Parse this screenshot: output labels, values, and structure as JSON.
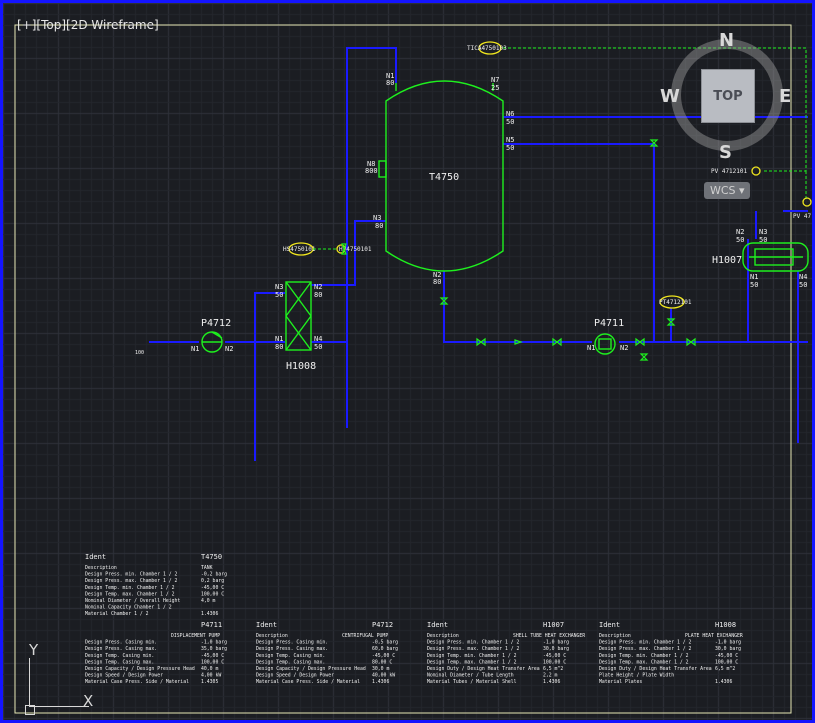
{
  "viewport": {
    "label": "[+][Top][2D Wireframe]",
    "background": "#1b1d22",
    "border_color": "#1414ff",
    "pipe_color": "#1a1aff",
    "equipment_color": "#1ef01e",
    "instrument_color": "#f0e61e",
    "text_color": "#f0f0f0"
  },
  "viewcube": {
    "face": "TOP",
    "north": "N",
    "south": "S",
    "east": "E",
    "west": "W",
    "wcs": "WCS"
  },
  "equipment": {
    "t4750": {
      "tag": "T4750",
      "n1": "N1",
      "n1s": "80",
      "n7": "N7",
      "n7s": "25",
      "n6": "N6",
      "n6s": "50",
      "n5": "N5",
      "n5s": "50",
      "n8": "N8",
      "n8s": "800",
      "n3": "N3",
      "n3s": "80",
      "n2": "N2",
      "n2s": "80"
    },
    "h1008": {
      "tag": "H1008",
      "n3": "N3",
      "n3s": "50",
      "n2": "N2",
      "n2s": "80",
      "n1": "N1",
      "n1s": "80",
      "n4": "N4",
      "n4s": "50"
    },
    "p4712": {
      "tag": "P4712",
      "n1": "N1",
      "n2": "N2",
      "inlet": "100"
    },
    "p4711": {
      "tag": "P4711",
      "n1": "N1",
      "n2": "N2"
    },
    "h1007": {
      "tag": "H1007",
      "n2": "N2",
      "n2s": "50",
      "n3": "N3",
      "n3s": "50",
      "n1": "N1",
      "n1s": "50",
      "n4": "N4",
      "n4s": "50"
    }
  },
  "instruments": {
    "tic": "TICA4750103",
    "hs": "HS4750101",
    "hv": "HV4750101",
    "pt": "PT4712101",
    "pv": "PV 4712101",
    "pvr": "PV 47"
  },
  "tables": {
    "t4750": {
      "header": [
        "Ident",
        "T4750"
      ],
      "rows": [
        [
          "Description",
          "TANK"
        ],
        [
          "Design Press. min. Chamber 1 / 2",
          "-0,2 barg"
        ],
        [
          "Design Press. max. Chamber 1 / 2",
          "0,2 barg"
        ],
        [
          "Design Temp. min. Chamber 1 / 2",
          "-45,00 C"
        ],
        [
          "Design Temp. max. Chamber 1 / 2",
          "100,00 C"
        ],
        [
          "Nominal Diameter / Overall Height",
          "4,0 m"
        ],
        [
          "Nominal Capacity Chamber 1 / 2",
          ""
        ],
        [
          "Material Chamber 1 / 2",
          "1.4306"
        ]
      ]
    },
    "p4711": {
      "header": [
        "",
        "P4711"
      ],
      "rows": [
        [
          "",
          "DISPLACEMENT PUMP"
        ],
        [
          "Design Press. Casing min.",
          "-1,0 barg"
        ],
        [
          "Design Press. Casing max.",
          "35,0 barg"
        ],
        [
          "Design Temp. Casing min.",
          "-45,00 C"
        ],
        [
          "Design Temp. Casing max.",
          "100,00 C"
        ],
        [
          "Design Capacity / Design Pressure Head",
          "40,0 m"
        ],
        [
          "Design Speed / Design Power",
          "4,00 kW"
        ],
        [
          "Material Case Press. Side / Material",
          "1.4305"
        ]
      ]
    },
    "p4712": {
      "header": [
        "Ident",
        "P4712"
      ],
      "rows": [
        [
          "Description",
          "CENTRIFUGAL PUMP"
        ],
        [
          "Design Press. Casing min.",
          "-0,5 barg"
        ],
        [
          "Design Press. Casing max.",
          "60,0 barg"
        ],
        [
          "Design Temp. Casing min.",
          "-45,00 C"
        ],
        [
          "Design Temp. Casing max.",
          "80,00 C"
        ],
        [
          "Design Capacity / Design Pressure Head",
          "30,0 m"
        ],
        [
          "Design Speed / Design Power",
          "40,00 kW"
        ],
        [
          "Material Case Press. Side / Material",
          "1.4306"
        ]
      ]
    },
    "h1007": {
      "header": [
        "Ident",
        "H1007"
      ],
      "rows": [
        [
          "Description",
          "SHELL TUBE HEAT EXCHANGER"
        ],
        [
          "Design Press. min. Chamber 1 / 2",
          "-1,0 barg"
        ],
        [
          "Design Press. max. Chamber 1 / 2",
          "30,0 barg"
        ],
        [
          "Design Temp. min. Chamber 1 / 2",
          "-45,00 C"
        ],
        [
          "Design Temp. max. Chamber 1 / 2",
          "100,00 C"
        ],
        [
          "Design Duty / Design Heat Transfer Area",
          "6,5 m^2"
        ],
        [
          "Nominal Diameter / Tube Length",
          "2,2 m"
        ],
        [
          "Material Tubes / Material Shell",
          "1.4306"
        ]
      ]
    },
    "h1008": {
      "header": [
        "Ident",
        "H1008"
      ],
      "rows": [
        [
          "Description",
          "PLATE HEAT EXCHANGER"
        ],
        [
          "Design Press. min. Chamber 1 / 2",
          "-1,0 barg"
        ],
        [
          "Design Press. max. Chamber 1 / 2",
          "30,0 barg"
        ],
        [
          "Design Temp. min. Chamber 1 / 2",
          "-45,00 C"
        ],
        [
          "Design Temp. max. Chamber 1 / 2",
          "100,00 C"
        ],
        [
          "Design Duty / Design Heat Transfer Area",
          "6,5 m^2"
        ],
        [
          "Plate Height / Plate Width",
          ""
        ],
        [
          "Material Plates",
          "1.4306"
        ]
      ]
    }
  }
}
